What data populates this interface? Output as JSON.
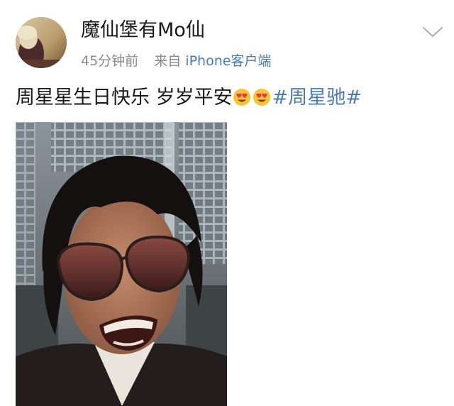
{
  "post": {
    "author": {
      "name": "魔仙堡有Mo仙",
      "avatar_icon": "user-avatar"
    },
    "meta": {
      "time": "45分钟前",
      "via_label": "来自",
      "device": "iPhone客户端"
    },
    "menu_icon": "chevron-down-icon",
    "content": {
      "text": "周星星生日快乐 岁岁平安",
      "emojis": [
        "heart-eyes-emoji",
        "heart-eyes-emoji"
      ],
      "hashtag": "#周星驰#"
    },
    "image": {
      "icon": "photo-thumbnail"
    }
  },
  "colors": {
    "link": "#4a7bb7",
    "text": "#1a1a1a",
    "meta": "#8a8a8a",
    "chevron": "#b0b0b0"
  }
}
